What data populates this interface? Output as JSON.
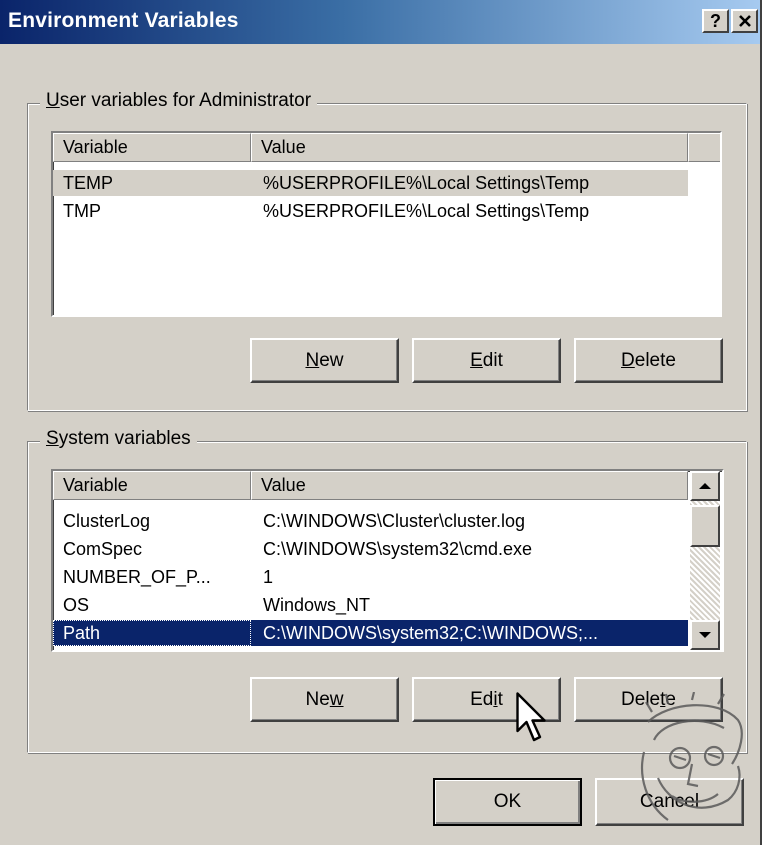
{
  "window": {
    "title": "Environment Variables",
    "help_label": "?",
    "colors": {
      "title_start": "#0a246a",
      "title_end": "#a6caf0",
      "face": "#d4d0c8",
      "selection": "#0a246a"
    }
  },
  "user_vars": {
    "group_prefix": "",
    "group_mnemonic": "U",
    "group_rest": "ser variables for Administrator",
    "columns": [
      "Variable",
      "Value"
    ],
    "rows": [
      {
        "variable": "TEMP",
        "value": "%USERPROFILE%\\Local Settings\\Temp"
      },
      {
        "variable": "TMP",
        "value": "%USERPROFILE%\\Local Settings\\Temp"
      }
    ],
    "buttons": {
      "new": {
        "pre": "",
        "key": "N",
        "post": "ew"
      },
      "edit": {
        "pre": "",
        "key": "E",
        "post": "dit"
      },
      "delete": {
        "pre": "",
        "key": "D",
        "post": "elete"
      }
    }
  },
  "system_vars": {
    "group_mnemonic": "S",
    "group_rest": "ystem variables",
    "columns": [
      "Variable",
      "Value"
    ],
    "rows": [
      {
        "variable": "ClusterLog",
        "value": "C:\\WINDOWS\\Cluster\\cluster.log"
      },
      {
        "variable": "ComSpec",
        "value": "C:\\WINDOWS\\system32\\cmd.exe"
      },
      {
        "variable": "NUMBER_OF_P...",
        "value": "1"
      },
      {
        "variable": "OS",
        "value": "Windows_NT"
      },
      {
        "variable": "Path",
        "value": "C:\\WINDOWS\\system32;C:\\WINDOWS;..."
      }
    ],
    "selected_row": "Path",
    "buttons": {
      "new": {
        "pre": "Ne",
        "key": "w",
        "post": ""
      },
      "edit": {
        "pre": "Ed",
        "key": "i",
        "post": "t"
      },
      "delete": {
        "pre": "Dele",
        "key": "t",
        "post": "e"
      }
    },
    "scrollbar_position": 0.1
  },
  "footer": {
    "ok_label": "OK",
    "cancel_label": "Cancel"
  },
  "icons": {
    "close": "close-icon",
    "scroll_up": "scroll-up-icon",
    "scroll_down": "scroll-down-icon",
    "cursor": "mouse-cursor-icon",
    "watermark": "watermark-seal-icon"
  }
}
